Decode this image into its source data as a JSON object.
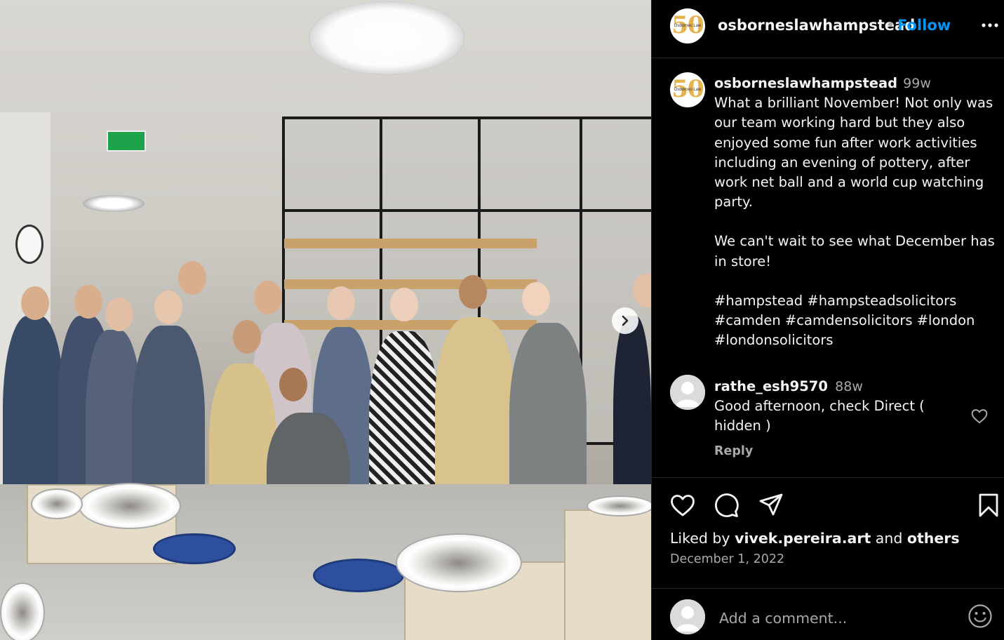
{
  "profile": {
    "username": "osborneslawhampstead",
    "separator": "•",
    "follow_label": "Follow",
    "avatar_text": "50",
    "avatar_brand": "Osbornes Law"
  },
  "post": {
    "username": "osborneslawhampstead",
    "time": "99w",
    "caption_lines": [
      "What a brilliant November! Not only was",
      "our team working hard but they also",
      "enjoyed some fun after work activities",
      "including an evening of pottery, after",
      "work net ball and a world cup watching",
      "party.",
      "",
      "We can't wait to see what December has",
      "in store!",
      "",
      "#hampstead #hampsteadsolicitors",
      "#camden #camdensolicitors #london",
      "#londonsolicitors"
    ]
  },
  "comments": [
    {
      "username": "rathe_esh9570",
      "time": "88w",
      "text_lines": [
        "Good afternoon, check Direct (",
        "hidden )"
      ],
      "reply_label": "Reply"
    }
  ],
  "likes": {
    "prefix": "Liked by",
    "user": "vivek.pereira.art",
    "middle": "and",
    "others": "others"
  },
  "date": "December 1, 2022",
  "add_comment": {
    "placeholder": "Add a comment..."
  },
  "icons": {
    "more": "more-horizontal-icon",
    "like": "heart-icon",
    "comment": "comment-bubble-icon",
    "share": "paper-plane-icon",
    "save": "bookmark-icon",
    "emoji": "smiley-icon",
    "next": "chevron-right-icon"
  },
  "colors": {
    "background": "#000000",
    "follow": "#0095f6",
    "secondary_text": "#a8a8a8",
    "primary_text": "#f5f5f5",
    "divider": "#262626"
  }
}
